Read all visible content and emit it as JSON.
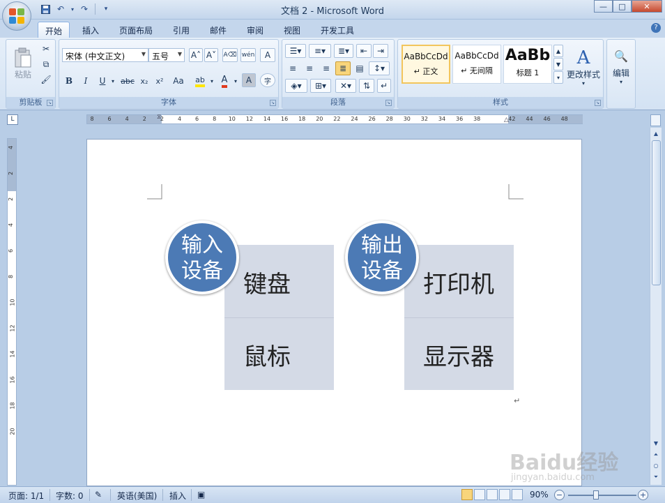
{
  "window": {
    "title": "文档 2 - Microsoft Word",
    "minimize": "—",
    "maximize": "□",
    "close": "✕"
  },
  "tabs": [
    {
      "label": "开始",
      "active": true
    },
    {
      "label": "插入"
    },
    {
      "label": "页面布局"
    },
    {
      "label": "引用"
    },
    {
      "label": "邮件"
    },
    {
      "label": "审阅"
    },
    {
      "label": "视图"
    },
    {
      "label": "开发工具"
    }
  ],
  "ribbon": {
    "clipboard": {
      "label": "剪贴板",
      "paste": "粘贴"
    },
    "font": {
      "label": "字体",
      "font_name": "宋体 (中文正文)",
      "font_size": "五号",
      "bold": "B",
      "italic": "I",
      "underline": "U",
      "strike": "abc",
      "subscript": "x₂",
      "superscript": "x²",
      "change_case": "Aa",
      "grow": "A˄",
      "shrink": "A˅",
      "phonetic": "wén",
      "border_char": "A",
      "enclose": "字"
    },
    "paragraph": {
      "label": "段落"
    },
    "styles": {
      "label": "样式",
      "items": [
        {
          "sample": "AaBbCcDd",
          "name": "↵ 正文"
        },
        {
          "sample": "AaBbCcDd",
          "name": "↵ 无间隔"
        },
        {
          "sample": "AaBb",
          "name": "标题 1"
        }
      ],
      "change_styles": "更改样式"
    },
    "editing": {
      "label": "编辑"
    }
  },
  "ruler": {
    "h_ticks": [
      "8",
      "6",
      "4",
      "2",
      "2",
      "4",
      "6",
      "8",
      "10",
      "12",
      "14",
      "16",
      "18",
      "20",
      "22",
      "24",
      "26",
      "28",
      "30",
      "32",
      "34",
      "36",
      "38",
      "42",
      "44",
      "46",
      "48"
    ],
    "v_ticks": [
      "4",
      "2",
      "2",
      "4",
      "6",
      "8",
      "10",
      "12",
      "14",
      "16",
      "18",
      "20"
    ]
  },
  "document": {
    "groups": [
      {
        "bubble": [
          "输入",
          "设备"
        ],
        "items": [
          "键盘",
          "鼠标"
        ]
      },
      {
        "bubble": [
          "输出",
          "设备"
        ],
        "items": [
          "打印机",
          "显示器"
        ]
      }
    ],
    "para_mark": "↵",
    "colors": {
      "bubble": "#4c7ab5",
      "tile": "#d4dae6"
    }
  },
  "statusbar": {
    "page": "页面: 1/1",
    "words": "字数: 0",
    "language": "英语(美国)",
    "mode": "插入",
    "zoom": "90%",
    "zoom_minus": "−",
    "zoom_plus": "+"
  },
  "watermark": {
    "brand": "Baidu经验",
    "url": "jingyan.baidu.com"
  }
}
